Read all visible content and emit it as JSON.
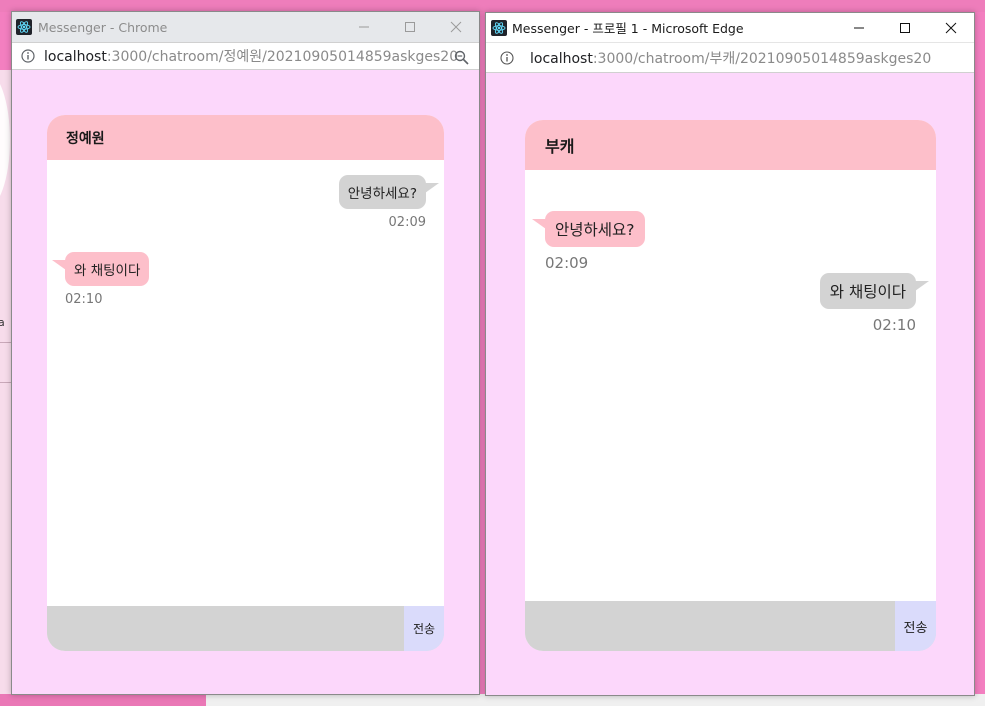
{
  "background": {
    "glyph": "a"
  },
  "left_window": {
    "title": "Messenger - Chrome",
    "url_host": "localhost",
    "url_path": ":3000/chatroom/정예원/20210905014859askges20",
    "chat": {
      "header": "정예원",
      "messages": [
        {
          "side": "mine",
          "text": "안녕하세요?",
          "time": "02:09"
        },
        {
          "side": "theirs",
          "text": "와 채팅이다",
          "time": "02:10"
        }
      ],
      "input_value": "",
      "send_label": "전송"
    }
  },
  "right_window": {
    "title": "Messenger - 프로필 1 - Microsoft Edge",
    "url_host": "localhost",
    "url_path": ":3000/chatroom/부캐/20210905014859askges20",
    "chat": {
      "header": "부캐",
      "messages": [
        {
          "side": "theirs",
          "text": "안녕하세요?",
          "time": "02:09"
        },
        {
          "side": "mine",
          "text": "와 채팅이다",
          "time": "02:10"
        }
      ],
      "input_value": "",
      "send_label": "전송"
    }
  },
  "colors": {
    "desktop": "#f37fc0",
    "window_bg": "#fcd7fb",
    "header_pink": "#fdbfca",
    "my_bubble": "#d3d3d3",
    "their_bubble": "#fdbfca",
    "send_button": "#dadbfb"
  },
  "icons": [
    "react-app-icon",
    "minimize-icon",
    "maximize-icon",
    "close-icon",
    "info-icon",
    "zoom-icon"
  ]
}
